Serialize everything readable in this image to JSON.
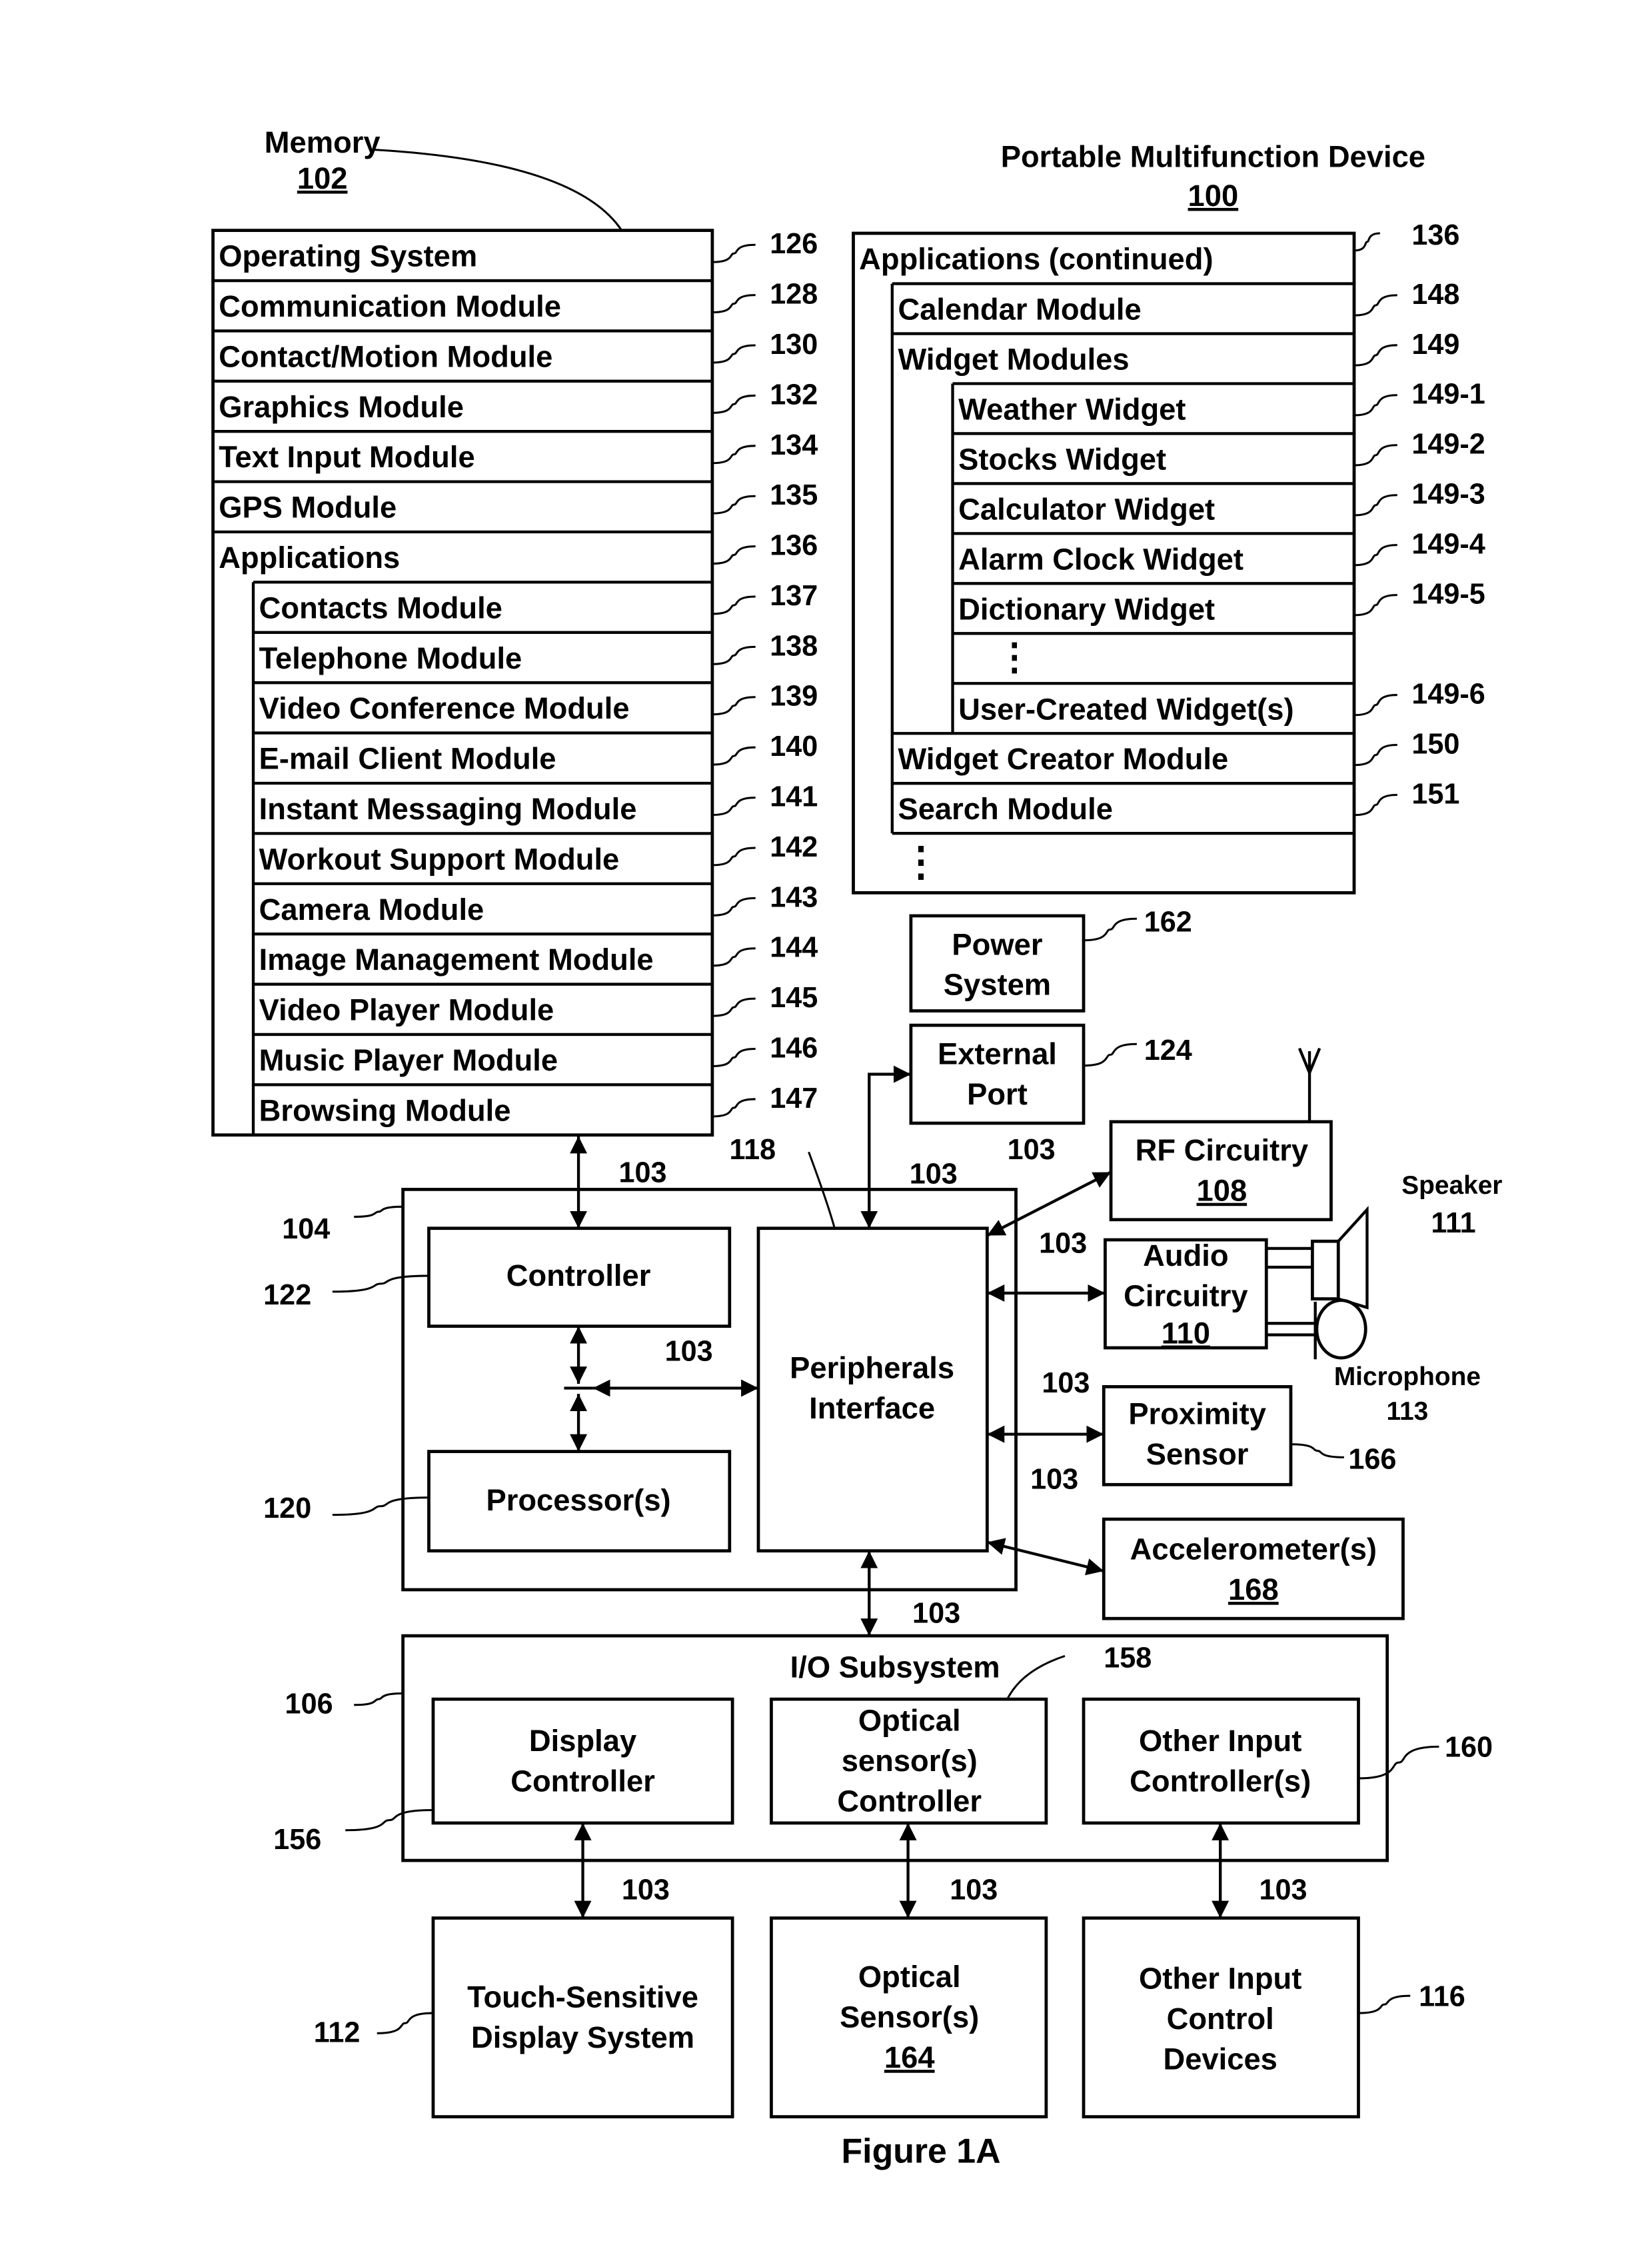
{
  "figure_caption": "Figure 1A",
  "device": {
    "title": "Portable Multifunction Device",
    "ref": "100"
  },
  "memory": {
    "title": "Memory",
    "ref": "102",
    "top_rows": [
      {
        "label": "Operating System",
        "ref": "126"
      },
      {
        "label": "Communication Module",
        "ref": "128"
      },
      {
        "label": "Contact/Motion Module",
        "ref": "130"
      },
      {
        "label": "Graphics Module",
        "ref": "132"
      },
      {
        "label": "Text Input Module",
        "ref": "134"
      },
      {
        "label": "GPS Module",
        "ref": "135"
      },
      {
        "label": "Applications",
        "ref": "136"
      }
    ],
    "applications": [
      {
        "label": "Contacts Module",
        "ref": "137"
      },
      {
        "label": "Telephone Module",
        "ref": "138"
      },
      {
        "label": "Video Conference Module",
        "ref": "139"
      },
      {
        "label": "E-mail Client Module",
        "ref": "140"
      },
      {
        "label": "Instant Messaging Module",
        "ref": "141"
      },
      {
        "label": "Workout Support Module",
        "ref": "142"
      },
      {
        "label": "Camera Module",
        "ref": "143"
      },
      {
        "label": "Image Management Module",
        "ref": "144"
      },
      {
        "label": "Video Player Module",
        "ref": "145"
      },
      {
        "label": "Music Player Module",
        "ref": "146"
      },
      {
        "label": "Browsing Module",
        "ref": "147"
      }
    ]
  },
  "applications_continued": {
    "title": "Applications (continued)",
    "ref": "136",
    "calendar": {
      "label": "Calendar Module",
      "ref": "148"
    },
    "widget_modules": {
      "label": "Widget Modules",
      "ref": "149"
    },
    "widgets": [
      {
        "label": "Weather Widget",
        "ref": "149-1"
      },
      {
        "label": "Stocks Widget",
        "ref": "149-2"
      },
      {
        "label": "Calculator Widget",
        "ref": "149-3"
      },
      {
        "label": "Alarm Clock Widget",
        "ref": "149-4"
      },
      {
        "label": "Dictionary Widget",
        "ref": "149-5"
      },
      {
        "label": "⋮",
        "ref": ""
      },
      {
        "label": "User-Created Widget(s)",
        "ref": "149-6"
      }
    ],
    "widget_creator": {
      "label": "Widget Creator Module",
      "ref": "150"
    },
    "search": {
      "label": "Search Module",
      "ref": "151"
    },
    "ellipsis": "⋮"
  },
  "power_system": {
    "lines": [
      "Power",
      "System"
    ],
    "ref": "162"
  },
  "external_port": {
    "lines": [
      "External",
      "Port"
    ],
    "ref": "124"
  },
  "rf_circuitry": {
    "lines": [
      "RF Circuitry"
    ],
    "ref_underlined": "108"
  },
  "speaker": {
    "label": "Speaker",
    "ref": "111"
  },
  "audio_circuitry": {
    "lines": [
      "Audio",
      "Circuitry"
    ],
    "ref_underlined": "110"
  },
  "microphone": {
    "label": "Microphone",
    "ref": "113"
  },
  "proximity_sensor": {
    "lines": [
      "Proximity",
      "Sensor"
    ],
    "ref": "166"
  },
  "accelerometers": {
    "lines": [
      "Accelerometer(s)"
    ],
    "ref_underlined": "168"
  },
  "core": {
    "ref": "104",
    "controller": {
      "label": "Controller",
      "ref": "122"
    },
    "processor": {
      "label": "Processor(s)",
      "ref": "120"
    },
    "peripherals": {
      "lines": [
        "Peripherals",
        "Interface"
      ],
      "ref": "118"
    }
  },
  "bus_ref": "103",
  "io_subsystem": {
    "title": "I/O Subsystem",
    "ref": "106",
    "display_controller": {
      "lines": [
        "Display",
        "Controller"
      ],
      "ref": "156"
    },
    "optical_controller": {
      "lines": [
        "Optical",
        "sensor(s)",
        "Controller"
      ],
      "ref": "158"
    },
    "other_input_controller": {
      "lines": [
        "Other Input",
        "Controller(s)"
      ],
      "ref": "160"
    }
  },
  "touch_display": {
    "lines": [
      "Touch-Sensitive",
      "Display System"
    ],
    "ref": "112"
  },
  "optical_sensors": {
    "lines": [
      "Optical",
      "Sensor(s)"
    ],
    "ref_underlined": "164"
  },
  "other_input_devices": {
    "lines": [
      "Other Input",
      "Control",
      "Devices"
    ],
    "ref": "116"
  }
}
